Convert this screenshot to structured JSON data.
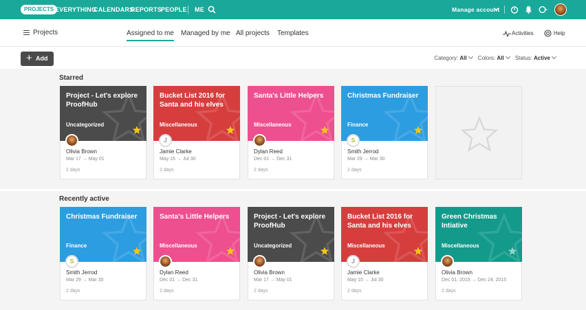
{
  "topnav": {
    "projects": "PROJECTS",
    "everything": "EVERYTHING",
    "calendars": "CALENDARS",
    "reports": "REPORTS",
    "people": "PEOPLE",
    "me": "ME",
    "manage_account": "Manage account"
  },
  "subheader": {
    "title": "Projects",
    "tabs": [
      "Assigned to me",
      "Managed by me",
      "All projects",
      "Templates"
    ],
    "activities": "Activities",
    "help": "Help"
  },
  "toolbar": {
    "add_label": "Add",
    "category_label": "Category:",
    "category_value": "All",
    "colors_label": "Colors:",
    "colors_value": "All",
    "status_label": "Status:",
    "status_value": "Active"
  },
  "starred": {
    "title": "Starred",
    "cards": [
      {
        "name": "Project - Let's explore ProofHub",
        "category": "Uncategorized",
        "color": "#4b4b4b",
        "owner": "Olivia Brown",
        "start": "Mar 17",
        "end": "May 01",
        "duration": "2 days",
        "avatar": "photo",
        "avatar_letter": "",
        "starred": true
      },
      {
        "name": "Bucket List 2016 for Santa and his elves",
        "category": "Miscellaneous",
        "color": "#d63e3e",
        "owner": "Jamie Clarke",
        "start": "May 15",
        "end": "Jul 30",
        "duration": "2 days",
        "avatar": "letter",
        "avatar_letter": "J",
        "starred": true
      },
      {
        "name": "Santa's Little Helpers",
        "category": "Miscellaneous",
        "color": "#ee4f8f",
        "owner": "Dylan Reed",
        "start": "Dec 01",
        "end": "Dec 31",
        "duration": "2 days",
        "avatar": "photo",
        "avatar_letter": "",
        "starred": true
      },
      {
        "name": "Christmas Fundraiser",
        "category": "Finance",
        "color": "#2c9de0",
        "owner": "Smith Jerrod",
        "start": "Mar 29",
        "end": "Mar 30",
        "duration": "2 days",
        "avatar": "letter-s",
        "avatar_letter": "S",
        "starred": true
      }
    ]
  },
  "recent": {
    "title": "Recently active",
    "cards": [
      {
        "name": "Christmas Fundraiser",
        "category": "Finance",
        "color": "#2c9de0",
        "owner": "Smith Jerrod",
        "start": "Mar 29",
        "end": "Mar 30",
        "duration": "2 days",
        "avatar": "letter-s",
        "avatar_letter": "S",
        "starred": true
      },
      {
        "name": "Santa's Little Helpers",
        "category": "Miscellaneous",
        "color": "#ee4f8f",
        "owner": "Dylan Reed",
        "start": "Dec 01",
        "end": "Dec 31",
        "duration": "2 days",
        "avatar": "photo",
        "avatar_letter": "",
        "starred": true
      },
      {
        "name": "Project - Let's explore ProofHub",
        "category": "Uncategorized",
        "color": "#4b4b4b",
        "owner": "Olivia Brown",
        "start": "Mar 17",
        "end": "May 01",
        "duration": "2 days",
        "avatar": "photo",
        "avatar_letter": "",
        "starred": true
      },
      {
        "name": "Bucket List 2016 for Santa and his elves",
        "category": "Miscellaneous",
        "color": "#d63e3e",
        "owner": "Jamie Clarke",
        "start": "May 15",
        "end": "Jul 30",
        "duration": "2 days",
        "avatar": "letter",
        "avatar_letter": "J",
        "starred": true
      },
      {
        "name": "Green Christmas Intiative",
        "category": "Miscellaneous",
        "color": "#139a8a",
        "owner": "Olivia Brown",
        "start": "Dec 01, 2015",
        "end": "Dec 24, 2015",
        "duration": "2 days",
        "avatar": "photo",
        "avatar_letter": "",
        "starred": false
      }
    ]
  },
  "colors": {
    "brand": "#1aa89a",
    "star_on": "#f5c518",
    "star_off": "#8fd4cb"
  }
}
